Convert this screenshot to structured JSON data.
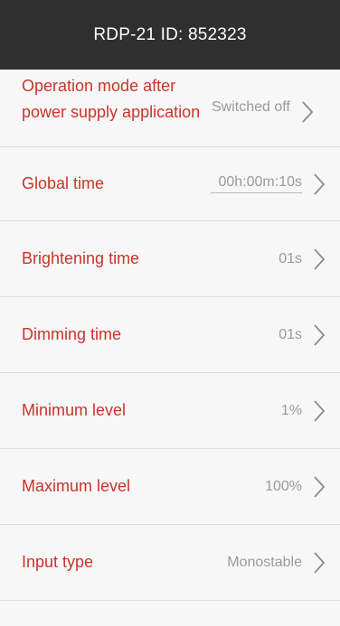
{
  "header": {
    "title": "RDP-21 ID: 852323"
  },
  "settings": [
    {
      "label": "Operation mode after power supply application",
      "value": "Switched off"
    },
    {
      "label": "Global time",
      "value": "00h:00m:10s"
    },
    {
      "label": "Brightening time",
      "value": "01s"
    },
    {
      "label": "Dimming time",
      "value": "01s"
    },
    {
      "label": "Minimum level",
      "value": "1%"
    },
    {
      "label": "Maximum level",
      "value": "100%"
    },
    {
      "label": "Input type",
      "value": "Monostable"
    }
  ],
  "colors": {
    "header_bg": "#2f2f2f",
    "label": "#c9342a",
    "value": "#9a9a9a",
    "background": "#f7f7f7"
  },
  "icons": {
    "row_arrow": "chevron-right-icon"
  }
}
